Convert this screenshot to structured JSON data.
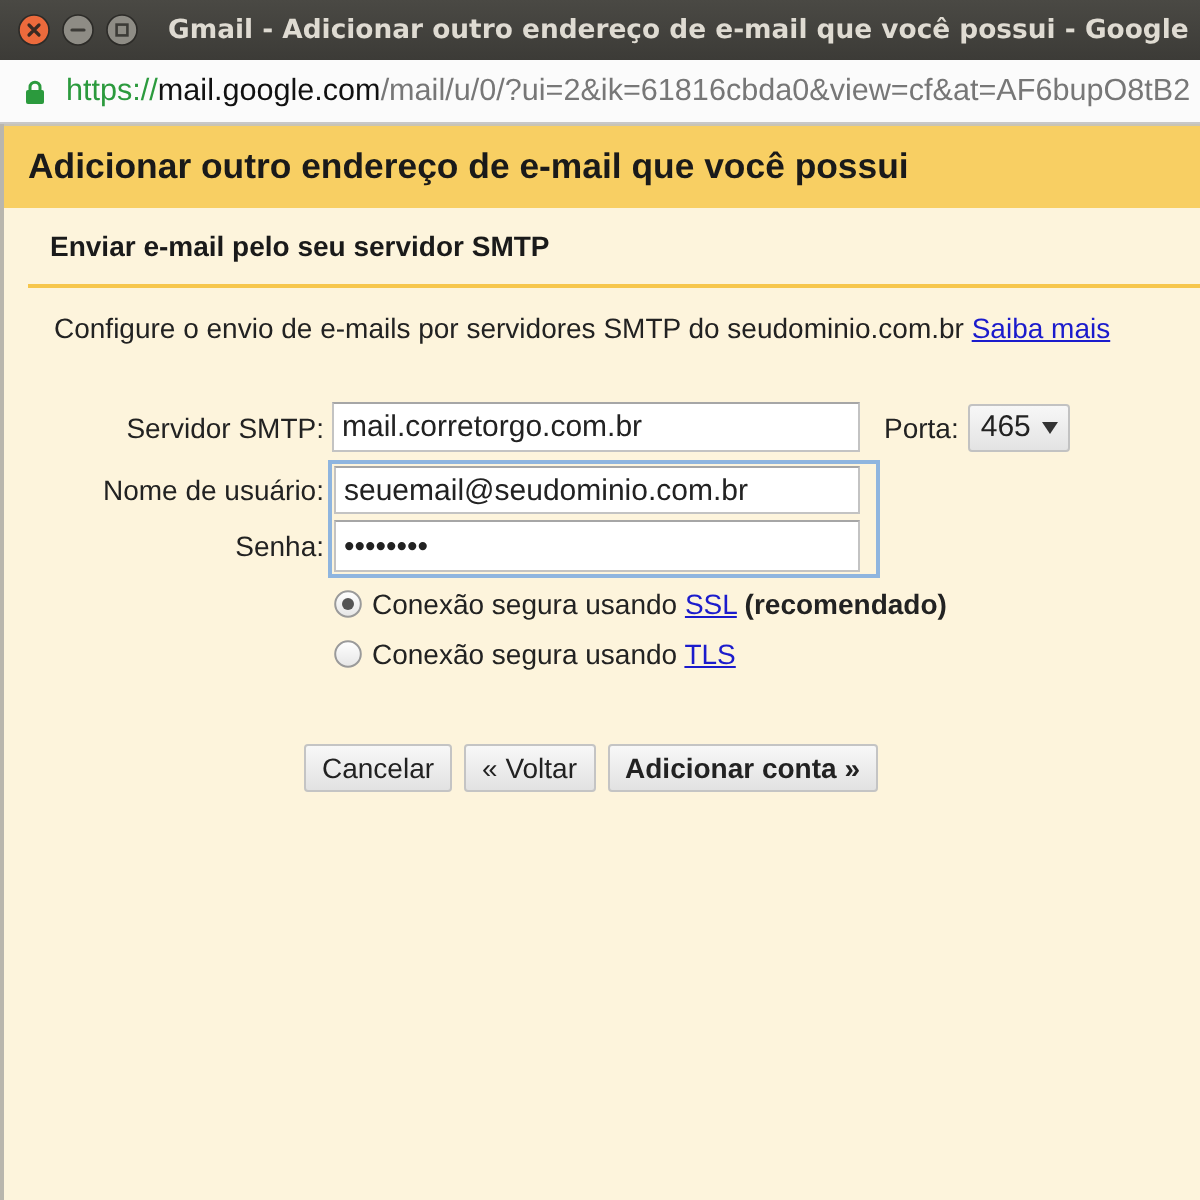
{
  "window": {
    "title": "Gmail - Adicionar outro endereço de e-mail que você possui - Google"
  },
  "address_bar": {
    "scheme": "https://",
    "host": "mail.google.com",
    "path": "/mail/u/0/?ui=2&ik=61816cbda0&view=cf&at=AF6bupO8tB2"
  },
  "dialog": {
    "title": "Adicionar outro endereço de e-mail que você possui",
    "subtitle": "Enviar e-mail pelo seu servidor SMTP",
    "description": "Configure o envio de e-mails por servidores SMTP do seudominio.com.br",
    "description_link": "Saiba mais"
  },
  "form": {
    "server": {
      "label": "Servidor SMTP:",
      "value": "mail.corretorgo.com.br"
    },
    "port": {
      "label": "Porta:",
      "value": "465"
    },
    "credentials": {
      "highlighted": true,
      "fields": [
        {
          "label": "Nome de usuário:",
          "value": "seuemail@seudominio.com.br"
        },
        {
          "label": "Senha:",
          "value": "••••••••"
        }
      ]
    },
    "security": [
      {
        "text": "Conexão segura usando",
        "link": "SSL",
        "note": "(recomendado)",
        "selected": true
      },
      {
        "text": "Conexão segura usando",
        "link": "TLS",
        "selected": false
      }
    ]
  },
  "buttons": [
    {
      "label": "Cancelar",
      "primary": false
    },
    {
      "label": "« Voltar",
      "primary": false
    },
    {
      "label": "Adicionar conta »",
      "primary": true
    }
  ]
}
